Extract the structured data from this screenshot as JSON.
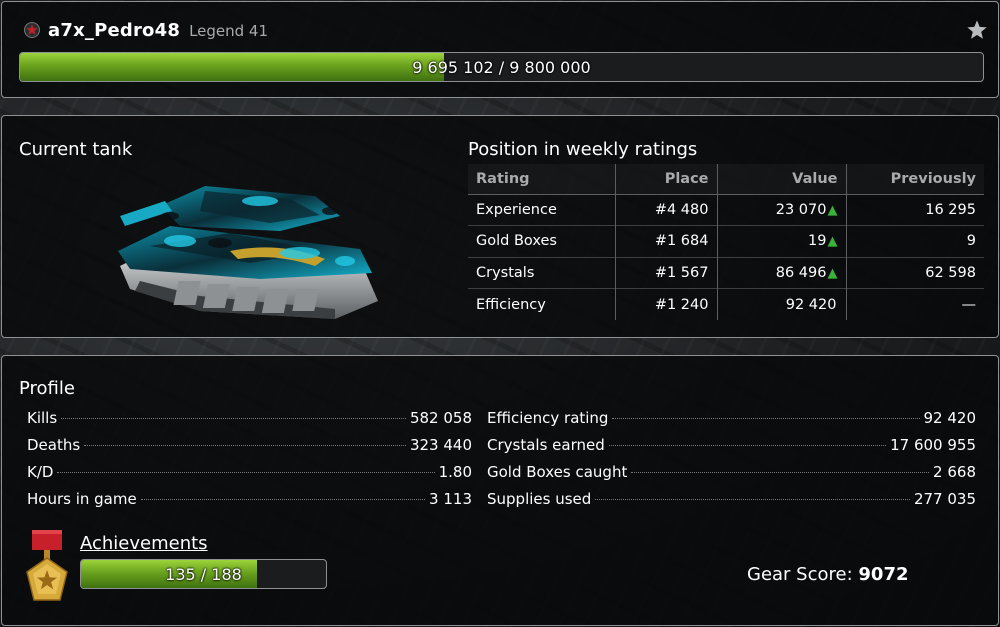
{
  "header": {
    "username": "a7x_Pedro48",
    "rank": "Legend 41",
    "experience_text": "9 695 102 / 9 800 000",
    "experience_current": 9695102,
    "experience_max": 9800000,
    "icons": {
      "rank": "rank-star-icon",
      "favorite": "star-icon"
    },
    "colors": {
      "bar_fill": "#7ab827",
      "rank_icon": "#c0202a"
    }
  },
  "current_tank": {
    "title": "Current tank",
    "image": "tank-icon"
  },
  "weekly_ratings": {
    "title": "Position in weekly ratings",
    "columns": [
      "Rating",
      "Place",
      "Value",
      "Previously"
    ],
    "rows": [
      {
        "rating": "Experience",
        "place": "#4 480",
        "value": "23 070",
        "trend": "▲",
        "previously": "16 295"
      },
      {
        "rating": "Gold Boxes",
        "place": "#1 684",
        "value": "19",
        "trend": "▲",
        "previously": "9"
      },
      {
        "rating": "Crystals",
        "place": "#1 567",
        "value": "86 496",
        "trend": "▲",
        "previously": "62 598"
      },
      {
        "rating": "Efficiency",
        "place": "#1 240",
        "value": "92 420",
        "trend": "",
        "previously": "—"
      }
    ],
    "colors": {
      "trend_up": "#3bb23b"
    }
  },
  "profile": {
    "title": "Profile",
    "left_stats": [
      {
        "label": "Kills",
        "value": "582 058"
      },
      {
        "label": "Deaths",
        "value": "323 440"
      },
      {
        "label": "K/D",
        "value": "1.80"
      },
      {
        "label": "Hours in game",
        "value": "3 113"
      }
    ],
    "right_stats": [
      {
        "label": "Efficiency rating",
        "value": "92 420"
      },
      {
        "label": "Crystals earned",
        "value": "17 600 955"
      },
      {
        "label": "Gold Boxes caught",
        "value": "2 668"
      },
      {
        "label": "Supplies used",
        "value": "277 035"
      }
    ],
    "achievements": {
      "label": "Achievements",
      "progress_text": "135 / 188",
      "current": 135,
      "total": 188,
      "icon": "medal-icon"
    },
    "gear_score": {
      "label": "Gear Score:",
      "value": "9072"
    }
  }
}
